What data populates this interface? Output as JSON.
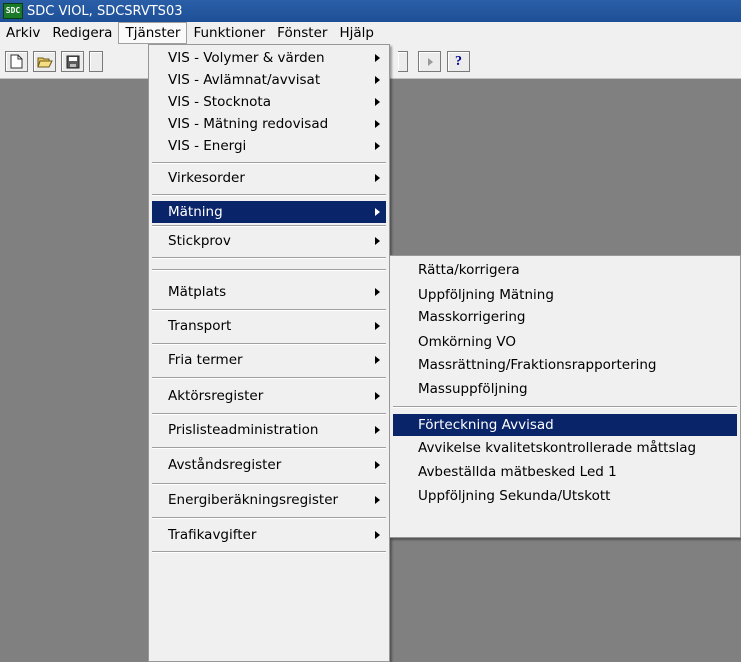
{
  "window": {
    "title": "SDC VIOL, SDCSRVTS03",
    "logo_text": "SDC"
  },
  "menubar": {
    "items": [
      "Arkiv",
      "Redigera",
      "Tjänster",
      "Funktioner",
      "Fönster",
      "Hjälp"
    ],
    "active": "Tjänster"
  },
  "toolbar": {
    "help_label": "?"
  },
  "tjanster_menu": {
    "items": [
      "VIS - Volymer & värden",
      "VIS - Avlämnat/avvisat",
      "VIS - Stocknota",
      "VIS - Mätning redovisad",
      "VIS - Energi",
      "Virkesorder",
      "Mätning",
      "Stickprov",
      "Mätplats",
      "Transport",
      "Fria termer",
      "Aktörsregister",
      "Prislisteadministration",
      "Avståndsregister",
      "Energiberäkningsregister",
      "Trafikavgifter"
    ],
    "highlighted": "Mätning"
  },
  "matning_submenu": {
    "items": [
      "Rätta/korrigera",
      "Uppföljning Mätning",
      "Masskorrigering",
      "Omkörning VO",
      "Massrättning/Fraktionsrapportering",
      "Massuppföljning",
      "Förteckning Avvisad",
      "Avvikelse kvalitetskontrollerade måttslag",
      "Avbeställda mätbesked Led 1",
      "Uppföljning Sekunda/Utskott"
    ],
    "highlighted": "Förteckning Avvisad"
  },
  "colors": {
    "highlight": "#0a246a",
    "titlebar": "#1e4f96",
    "workspace": "#808080",
    "menu": "#f0f0f0"
  }
}
